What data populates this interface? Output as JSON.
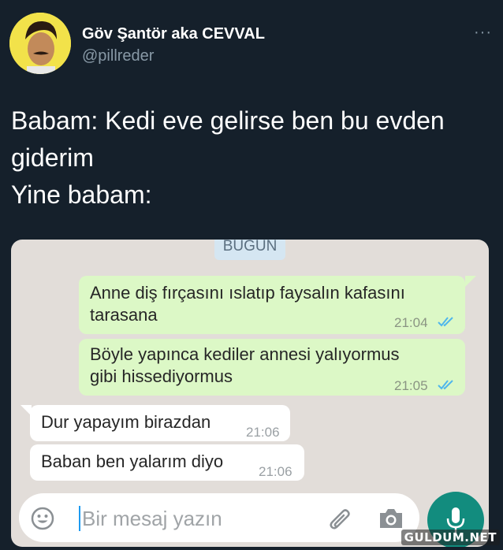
{
  "tweet": {
    "author_name": "Göv Şantör aka CEVVAL",
    "author_handle": "@pillreder",
    "more_label": "···",
    "text_lines": [
      "Babam: Kedi eve gelirse ben bu evden",
      "giderim",
      "Yine babam:"
    ]
  },
  "chat": {
    "date_chip": "BUGÜN",
    "messages": [
      {
        "direction": "out",
        "lines": [
          "Anne diş fırçasını ıslatıp faysalın kafasını",
          "tarasana"
        ],
        "time": "21:04",
        "status": "read"
      },
      {
        "direction": "out",
        "lines": [
          "Böyle yapınca kediler annesi yalıyormus",
          "gibi hissediyormus"
        ],
        "time": "21:05",
        "status": "read"
      },
      {
        "direction": "in",
        "lines": [
          "Dur yapayım birazdan"
        ],
        "time": "21:06"
      },
      {
        "direction": "in",
        "lines": [
          "Baban ben yalarım diyo"
        ],
        "time": "21:06"
      }
    ],
    "input": {
      "placeholder": "Bir mesaj yazın"
    },
    "icons": {
      "emoji": "emoji-icon",
      "attach": "paperclip-icon",
      "camera": "camera-icon",
      "mic": "microphone-icon"
    },
    "colors": {
      "outgoing_bubble": "#dcf8c6",
      "incoming_bubble": "#ffffff",
      "chat_background": "#e2ddd9",
      "read_ticks": "#4fb6ec",
      "mic_button": "#128c7e"
    }
  },
  "watermark": "GULDUM.NET",
  "page_background": "#15202b"
}
